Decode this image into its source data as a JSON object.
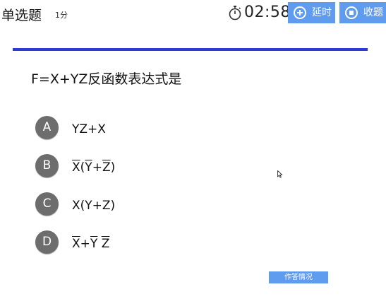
{
  "header": {
    "question_type": "单选题",
    "score": "1分",
    "timer": "02:58",
    "timer_icon": "stopwatch-icon",
    "extend_button": {
      "label": "延时",
      "icon": "plus-circle-icon"
    },
    "submit_button": {
      "label": "收题",
      "icon": "stop-circle-icon"
    }
  },
  "colors": {
    "accent_button": "#5f9bef",
    "divider": "#2e39d6",
    "option_badge": "#6d6d6d"
  },
  "question": {
    "text": "F=X+YZ反函数表达式是"
  },
  "options": [
    {
      "letter": "A",
      "parts": [
        "YZ+X"
      ]
    },
    {
      "letter": "B",
      "parts": [
        "X",
        "(",
        "Y",
        "+",
        "Z",
        ")"
      ]
    },
    {
      "letter": "C",
      "parts": [
        "X(Y+Z)"
      ]
    },
    {
      "letter": "D",
      "parts": [
        "X",
        "+",
        "Y",
        " ",
        "Z"
      ]
    }
  ],
  "footer": {
    "status_button": "作答情况"
  }
}
